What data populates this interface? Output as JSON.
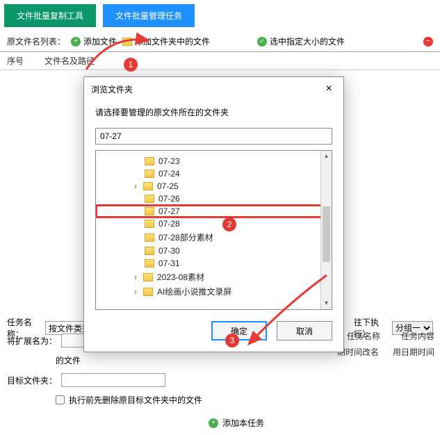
{
  "top": {
    "copy_tool": "文件批量复制工具",
    "manage_task": "文件批量管理任务"
  },
  "toolbar": {
    "list_label": "原文件名列表：",
    "add_file": "添加文件",
    "add_folder": "添加文件夹中的文件",
    "select_size": "选中指定大小的文件"
  },
  "headers": {
    "seq": "序号",
    "path": "文件名及路径"
  },
  "task": {
    "name_label": "任务名称：",
    "name_value": "按文件类型",
    "next_label": "往下执行）",
    "group_label": "分组一"
  },
  "form": {
    "ext_label": "将扩展名为：",
    "ext_suffix": "的文件",
    "target_label": "目标文件夹：",
    "del_checkbox": "执行前先删除原目标文件夹中的文件"
  },
  "right": {
    "task_name": "任务名称",
    "task_content": "任务内容",
    "rename_time": "期时间改名",
    "use_date": "用日期时间"
  },
  "add_task_btn": "添加本任务",
  "dialog": {
    "title": "浏览文件夹",
    "message": "请选择要管理的原文件所在的文件夹",
    "input_value": "07-27",
    "ok": "确定",
    "cancel": "取消",
    "items": [
      {
        "label": "07-23",
        "exp": false
      },
      {
        "label": "07-24",
        "exp": false
      },
      {
        "label": "07-25",
        "exp": true
      },
      {
        "label": "07-26",
        "exp": false
      },
      {
        "label": "07-27",
        "exp": false,
        "sel": true
      },
      {
        "label": "07-28",
        "exp": false
      },
      {
        "label": "07-28部分素材",
        "exp": false
      },
      {
        "label": "07-30",
        "exp": false
      },
      {
        "label": "07-31",
        "exp": false
      },
      {
        "label": "2023-08素材",
        "exp": true
      },
      {
        "label": "AI绘画小说推文录屏",
        "exp": true
      }
    ]
  },
  "anno": {
    "a1": "1",
    "a2": "2",
    "a3": "3"
  }
}
